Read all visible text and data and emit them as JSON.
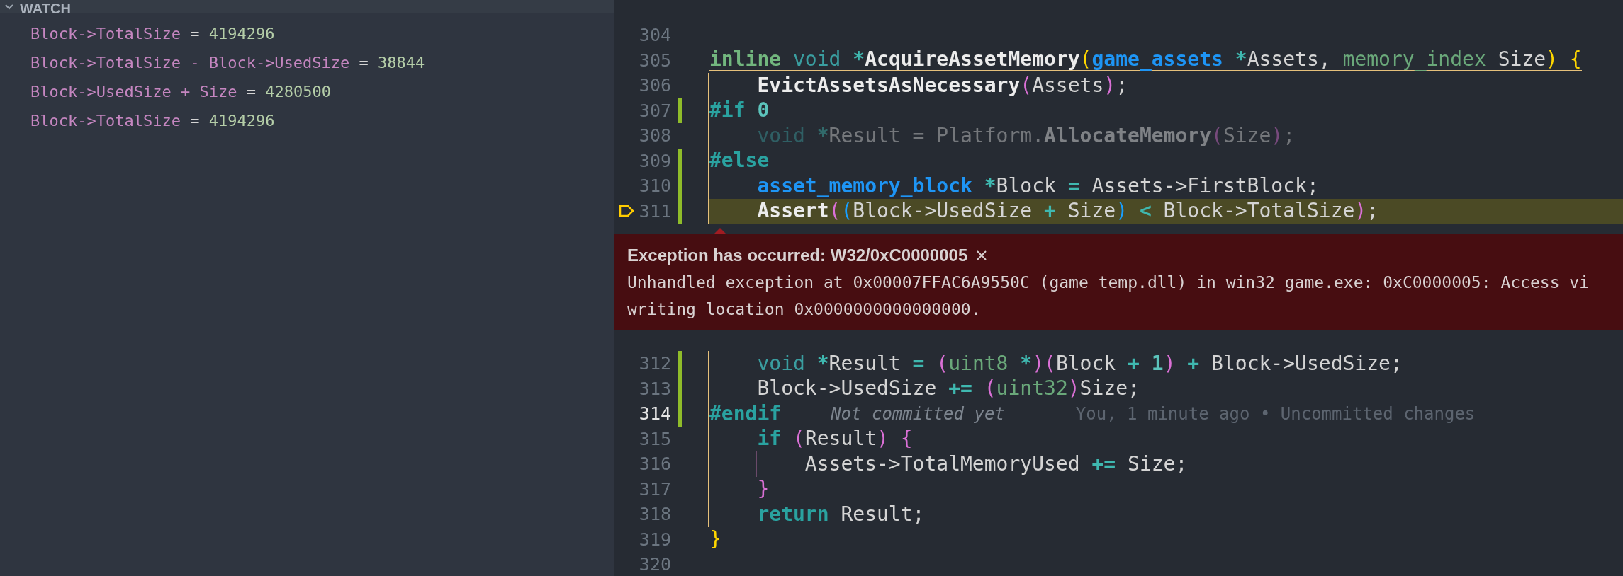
{
  "watch": {
    "title": "WATCH",
    "expanded": true,
    "items": [
      {
        "expression": "Block->TotalSize",
        "operator": "=",
        "value": "4194296"
      },
      {
        "expression": "Block->TotalSize - Block->UsedSize",
        "operator": "=",
        "value": "38844"
      },
      {
        "expression": "Block->UsedSize + Size",
        "operator": "=",
        "value": "4280500"
      },
      {
        "expression": "Block->TotalSize",
        "operator": "=",
        "value": "4194296"
      }
    ]
  },
  "code_before": [
    {
      "number": "304"
    },
    {
      "number": "305",
      "scope_start": true,
      "tokens": [
        {
          "t": "inline",
          "kind": "kwgreen"
        },
        {
          "t": " void",
          "kind": "kwteal"
        },
        {
          "t": " *",
          "kind": "op"
        },
        {
          "t": "AcquireAssetMemory",
          "kind": "func"
        },
        {
          "t": "(",
          "kind": "bracket1"
        },
        {
          "t": "game_assets",
          "kind": "type"
        },
        {
          "t": " *",
          "kind": "op"
        },
        {
          "t": "Assets,"
        },
        {
          "t": " memory_index",
          "kind": "type2"
        },
        {
          "t": " Size"
        },
        {
          "t": ")",
          "kind": "bracket1"
        },
        {
          "t": " {",
          "kind": "bracket1"
        }
      ]
    },
    {
      "number": "306",
      "scope": true,
      "tokens": [
        {
          "t": "    EvictAssetsAsNecessary",
          "kind": "func"
        },
        {
          "t": "(",
          "kind": "bracket2"
        },
        {
          "t": "Assets"
        },
        {
          "t": ")",
          "kind": "bracket2"
        },
        {
          "t": ";"
        }
      ]
    },
    {
      "number": "307",
      "scope": true,
      "git_change": true,
      "tokens": [
        {
          "t": "#if",
          "kind": "preproc"
        },
        {
          "t": " 0",
          "kind": "number"
        }
      ]
    },
    {
      "number": "308",
      "scope": true,
      "inactive": true,
      "tokens": [
        {
          "t": "    void",
          "kind": "kwteal"
        },
        {
          "t": " *",
          "kind": "op"
        },
        {
          "t": "Result = Platform."
        },
        {
          "t": "AllocateMemory",
          "kind": "func"
        },
        {
          "t": "(",
          "kind": "bracket2"
        },
        {
          "t": "Size"
        },
        {
          "t": ")",
          "kind": "bracket2"
        },
        {
          "t": ";"
        }
      ]
    },
    {
      "number": "309",
      "scope": true,
      "git_change": true,
      "tokens": [
        {
          "t": "#else",
          "kind": "preproc"
        }
      ]
    },
    {
      "number": "310",
      "scope": true,
      "git_change": true,
      "tokens": [
        {
          "t": "    asset_memory_block",
          "kind": "type"
        },
        {
          "t": " *",
          "kind": "op"
        },
        {
          "t": "Block"
        },
        {
          "t": " =",
          "kind": "op"
        },
        {
          "t": " Assets->FirstBlock;"
        }
      ]
    },
    {
      "number": "311",
      "scope": true,
      "git_change": true,
      "paused": true,
      "tokens": [
        {
          "t": "    Assert",
          "kind": "func"
        },
        {
          "t": "(",
          "kind": "bracket2"
        },
        {
          "t": "(",
          "kind": "bracket3"
        },
        {
          "t": "Block->UsedSize"
        },
        {
          "t": " +",
          "kind": "op"
        },
        {
          "t": " Size"
        },
        {
          "t": ")",
          "kind": "bracket3"
        },
        {
          "t": " <",
          "kind": "op"
        },
        {
          "t": " Block->TotalSize"
        },
        {
          "t": ")",
          "kind": "bracket2"
        },
        {
          "t": ";"
        }
      ]
    }
  ],
  "exception": {
    "title": "Exception has occurred: W32/0xC0000005",
    "message_lines": [
      "Unhandled exception at 0x00007FFAC6A9550C (game_temp.dll) in win32_game.exe: 0xC0000005: Access vi",
      "writing location 0x0000000000000000."
    ]
  },
  "code_after": [
    {
      "number": "312",
      "scope": true,
      "git_change": true,
      "tokens": [
        {
          "t": "    void",
          "kind": "kwteal"
        },
        {
          "t": " *",
          "kind": "op"
        },
        {
          "t": "Result"
        },
        {
          "t": " =",
          "kind": "op"
        },
        {
          "t": " (",
          "kind": "bracket2"
        },
        {
          "t": "uint8",
          "kind": "type2"
        },
        {
          "t": " *",
          "kind": "op"
        },
        {
          "t": ")",
          "kind": "bracket2"
        },
        {
          "t": "(",
          "kind": "bracket2"
        },
        {
          "t": "Block"
        },
        {
          "t": " +",
          "kind": "op"
        },
        {
          "t": " 1",
          "kind": "number"
        },
        {
          "t": ")",
          "kind": "bracket2"
        },
        {
          "t": " +",
          "kind": "op"
        },
        {
          "t": " Block->UsedSize;"
        }
      ]
    },
    {
      "number": "313",
      "scope": true,
      "git_change": true,
      "tokens": [
        {
          "t": "    Block->UsedSize"
        },
        {
          "t": " +=",
          "kind": "op"
        },
        {
          "t": " (",
          "kind": "bracket2"
        },
        {
          "t": "uint32",
          "kind": "type2"
        },
        {
          "t": ")",
          "kind": "bracket2"
        },
        {
          "t": "Size;"
        }
      ]
    },
    {
      "number": "314",
      "scope": true,
      "git_change": true,
      "cursor": true,
      "tokens": [
        {
          "t": "#endif",
          "kind": "preproc"
        }
      ],
      "blame": {
        "note": "Not committed yet",
        "detail": "You, 1 minute ago • Uncommitted changes"
      }
    },
    {
      "number": "315",
      "scope": true,
      "tokens": [
        {
          "t": "    if",
          "kind": "keyword"
        },
        {
          "t": " (",
          "kind": "bracket2"
        },
        {
          "t": "Result"
        },
        {
          "t": ")",
          "kind": "bracket2"
        },
        {
          "t": " {",
          "kind": "bracket2"
        }
      ]
    },
    {
      "number": "316",
      "scope": true,
      "guide": true,
      "tokens": [
        {
          "t": "        Assets->TotalMemoryUsed"
        },
        {
          "t": " +=",
          "kind": "op"
        },
        {
          "t": " Size;"
        }
      ]
    },
    {
      "number": "317",
      "scope": true,
      "tokens": [
        {
          "t": "    }",
          "kind": "bracket2"
        }
      ]
    },
    {
      "number": "318",
      "scope": true,
      "tokens": [
        {
          "t": "    return",
          "kind": "keyword"
        },
        {
          "t": " Result;"
        }
      ]
    },
    {
      "number": "319",
      "tokens": [
        {
          "t": "}",
          "kind": "bracket1"
        }
      ]
    },
    {
      "number": "320"
    }
  ]
}
